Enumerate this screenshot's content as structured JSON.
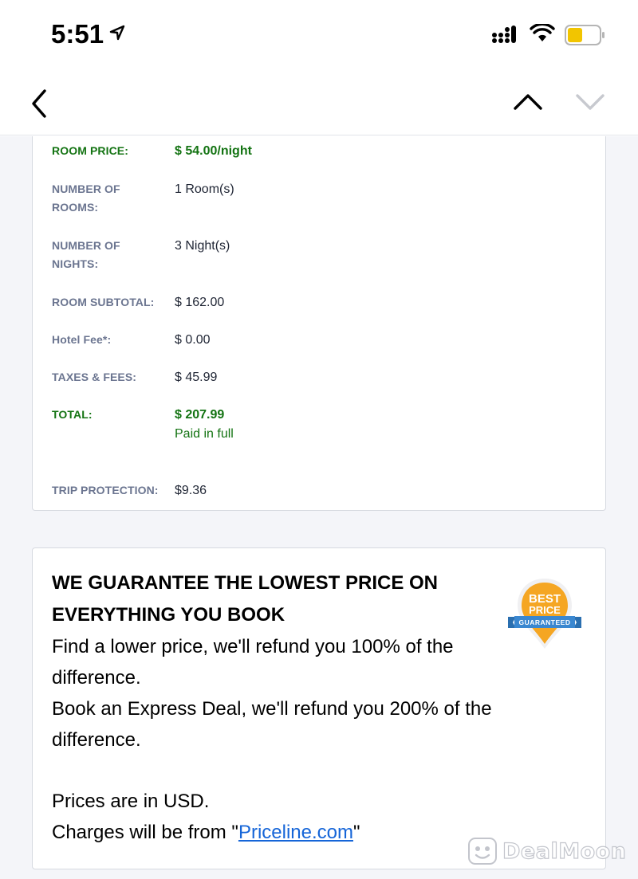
{
  "status_bar": {
    "time": "5:51"
  },
  "nav": {
    "back_icon": "chevron-left-icon",
    "prev_icon": "chevron-up-icon",
    "next_icon": "chevron-down-icon"
  },
  "details": {
    "rows": [
      {
        "label": "ROOM PRICE:",
        "value": "$ 54.00/night"
      },
      {
        "label_line1": "NUMBER OF",
        "label_line2": "ROOMS:",
        "value": "1 Room(s)"
      },
      {
        "label_line1": "NUMBER OF",
        "label_line2": "NIGHTS:",
        "value": "3 Night(s)"
      },
      {
        "label": "ROOM SUBTOTAL:",
        "value": "$ 162.00"
      },
      {
        "label": "Hotel Fee*:",
        "value": "$ 0.00"
      },
      {
        "label": "TAXES & FEES:",
        "value": "$ 45.99"
      },
      {
        "label": "TOTAL:",
        "value": "$ 207.99",
        "sub": "Paid in full"
      },
      {
        "label": "TRIP PROTECTION:",
        "value": "$9.36"
      }
    ]
  },
  "guarantee": {
    "title": "WE GUARANTEE THE LOWEST PRICE ON EVERYTHING YOU BOOK",
    "line1": "Find a lower price, we'll refund you 100% of the",
    "line2": "difference.",
    "line3": "Book an Express Deal, we'll refund you 200% of the",
    "line4": "difference.",
    "line5": "Prices are in USD.",
    "charges_prefix": "Charges will be from \"",
    "charges_link": "Priceline.com",
    "charges_suffix": "\"",
    "badge": {
      "line1": "BEST",
      "line2": "PRICE",
      "ribbon": "GUARANTEED"
    }
  },
  "watermark": {
    "text": "DealMoon"
  },
  "colors": {
    "green": "#137312",
    "link": "#1565d8",
    "label_gray": "#6b7590",
    "badge_orange": "#f5a623",
    "ribbon_blue": "#3a87d0"
  }
}
